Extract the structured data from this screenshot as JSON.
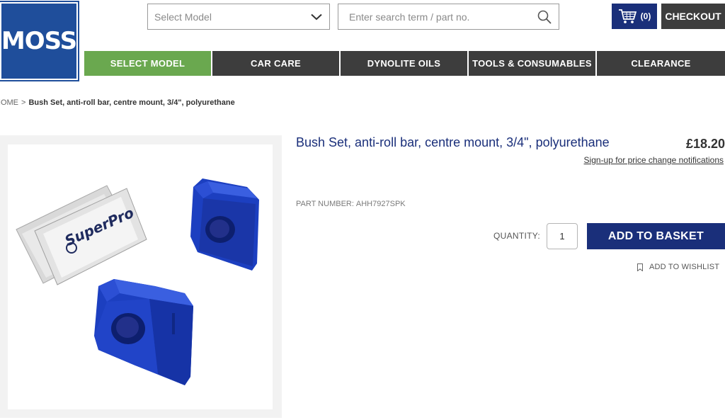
{
  "brand": {
    "logo_text": "MOSS",
    "color": "#1f4e9b"
  },
  "header": {
    "select_model_placeholder": "Select Model",
    "search_placeholder": "Enter search term / part no.",
    "basket_count": "(0)",
    "checkout_label": "CHECKOUT"
  },
  "nav": {
    "items": [
      {
        "label": "SELECT MODEL",
        "active": true
      },
      {
        "label": "CAR CARE"
      },
      {
        "label": "DYNOLITE OILS"
      },
      {
        "label": "TOOLS & CONSUMABLES"
      },
      {
        "label": "CLEARANCE"
      }
    ]
  },
  "breadcrumb": {
    "home": "HOME",
    "separator": ">",
    "current": "Bush Set, anti-roll bar, centre mount, 3/4\", polyurethane"
  },
  "product": {
    "title": "Bush Set, anti-roll bar, centre mount, 3/4\", polyurethane",
    "price": "£18.20",
    "price_alert_link": "Sign-up for price change notifications",
    "part_number_label": "PART NUMBER:",
    "part_number": "AHH7927SPK",
    "quantity_label": "QUANTITY:",
    "quantity_value": "1",
    "add_to_basket_label": "ADD TO BASKET",
    "wishlist_label": "ADD TO WISHLIST",
    "image": {
      "sachet_text": "SuperPro"
    }
  },
  "colors": {
    "navy": "#1a2f7a",
    "green": "#6aa84f",
    "dark_grey": "#3d3d3d",
    "bush_blue": "#1c3fc0"
  },
  "icons": {
    "dropdown": "chevron-down-icon",
    "search": "search-icon",
    "basket": "shopping-cart-icon",
    "wishlist": "bookmark-icon"
  }
}
